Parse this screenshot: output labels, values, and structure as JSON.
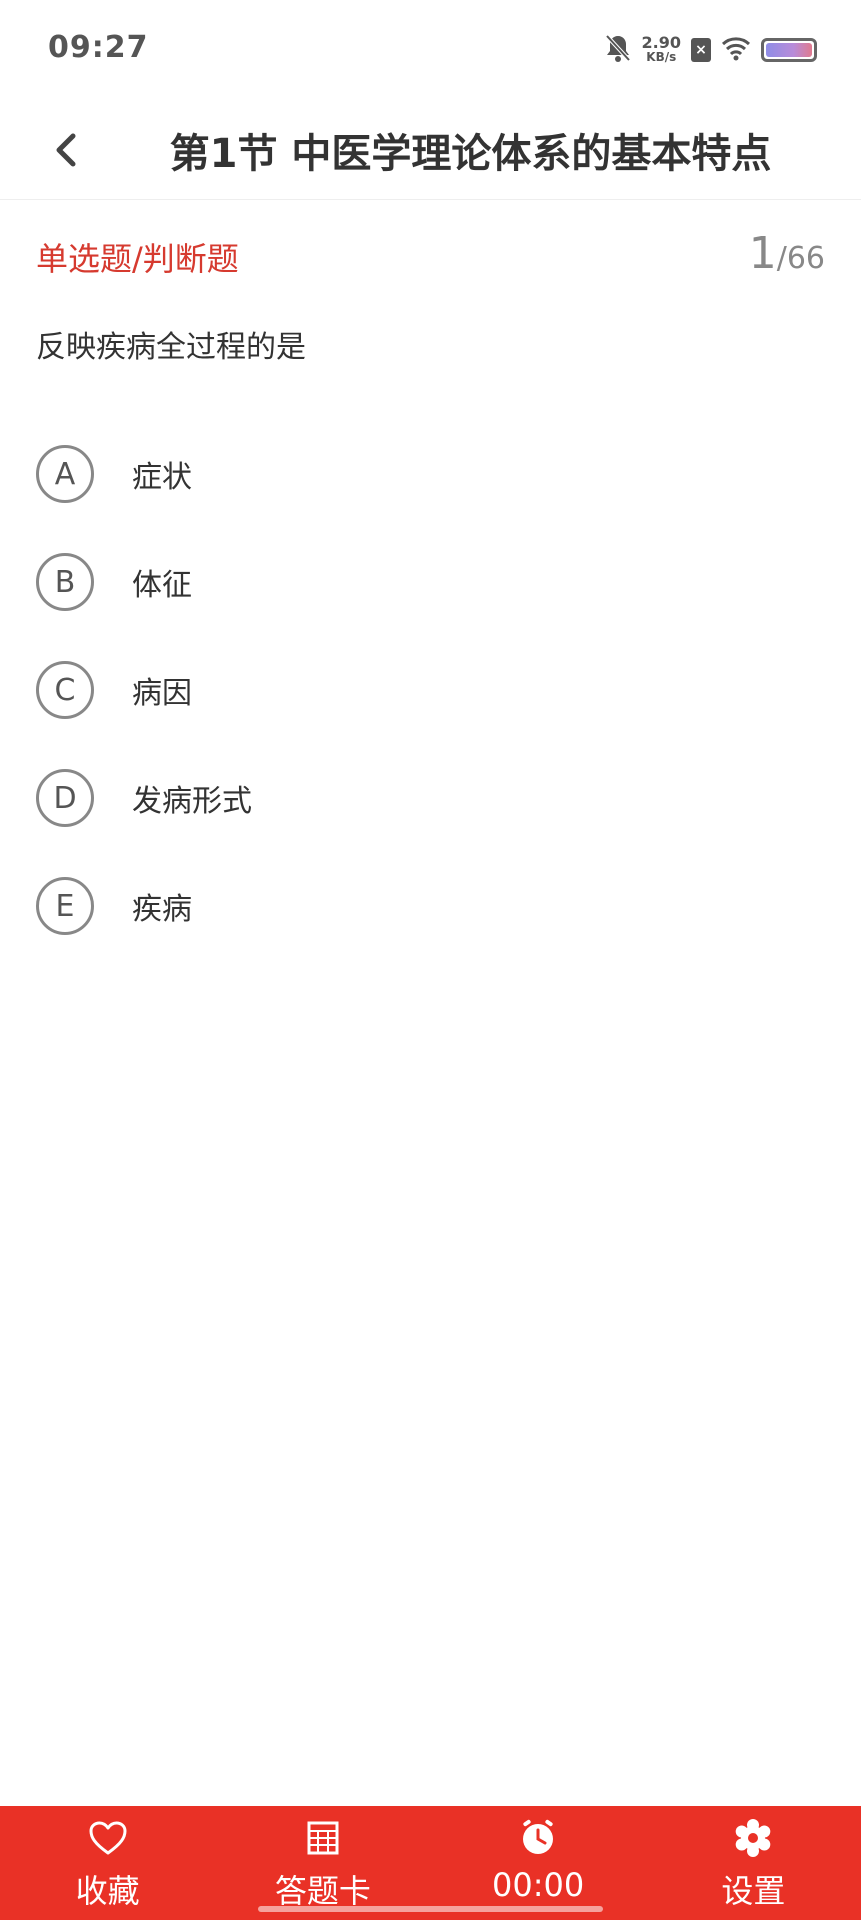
{
  "status_bar": {
    "time": "09:27",
    "net_speed_value": "2.90",
    "net_speed_unit": "KB/s",
    "sim_badge": "×",
    "icons": [
      "bell-mute-icon",
      "sim-x-icon",
      "wifi-icon",
      "battery-icon"
    ]
  },
  "header": {
    "title": "第1节 中医学理论体系的基本特点",
    "back_icon": "chevron-left-icon"
  },
  "question": {
    "type": "单选题/判断题",
    "current": "1",
    "separator": "/",
    "total": "66",
    "stem": "反映疾病全过程的是",
    "options": [
      {
        "letter": "A",
        "text": "症状"
      },
      {
        "letter": "B",
        "text": "体征"
      },
      {
        "letter": "C",
        "text": "病因"
      },
      {
        "letter": "D",
        "text": "发病形式"
      },
      {
        "letter": "E",
        "text": "疾病"
      }
    ]
  },
  "bottom_bar": {
    "favorite_label": "收藏",
    "answer_card_label": "答题卡",
    "timer_label": "00:00",
    "settings_label": "设置"
  },
  "colors": {
    "accent": "#e93126",
    "question_type": "#d63a2f",
    "text": "#333333",
    "muted": "#888888"
  }
}
